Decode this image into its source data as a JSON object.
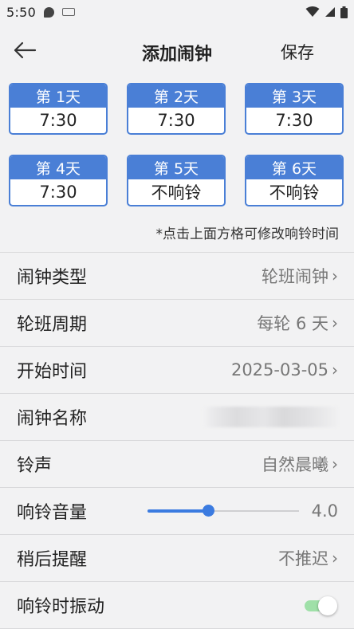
{
  "status_bar": {
    "time": "5:50",
    "icons": [
      "chat-icon",
      "keyboard-icon",
      "wifi-icon",
      "signal-icon",
      "battery-icon"
    ]
  },
  "app_bar": {
    "title": "添加闹钟",
    "save_label": "保存",
    "back_icon": "arrow-left-icon"
  },
  "days": [
    {
      "label": "第 1天",
      "time": "7:30"
    },
    {
      "label": "第 2天",
      "time": "7:30"
    },
    {
      "label": "第 3天",
      "time": "7:30"
    },
    {
      "label": "第 4天",
      "time": "7:30"
    },
    {
      "label": "第 5天",
      "time": "不响铃"
    },
    {
      "label": "第 6天",
      "time": "不响铃"
    }
  ],
  "hint": "*点击上面方格可修改响铃时间",
  "settings": {
    "alarm_type": {
      "label": "闹钟类型",
      "value": "轮班闹钟"
    },
    "shift_cycle": {
      "label": "轮班周期",
      "value": "每轮 6 天"
    },
    "start_time": {
      "label": "开始时间",
      "value": "2025-03-05"
    },
    "alarm_name": {
      "label": "闹钟名称"
    },
    "ringtone": {
      "label": "铃声",
      "value": "自然晨曦"
    },
    "volume": {
      "label": "响铃音量",
      "value": "4.0",
      "fraction": 0.4
    },
    "snooze": {
      "label": "稍后提醒",
      "value": "不推迟"
    },
    "vibrate": {
      "label": "响铃时振动",
      "on": true
    }
  },
  "colors": {
    "accent": "#4a7fd6",
    "slider": "#3b7be0",
    "toggle_track": "#9fe0a8",
    "background": "#f2f2f3"
  }
}
